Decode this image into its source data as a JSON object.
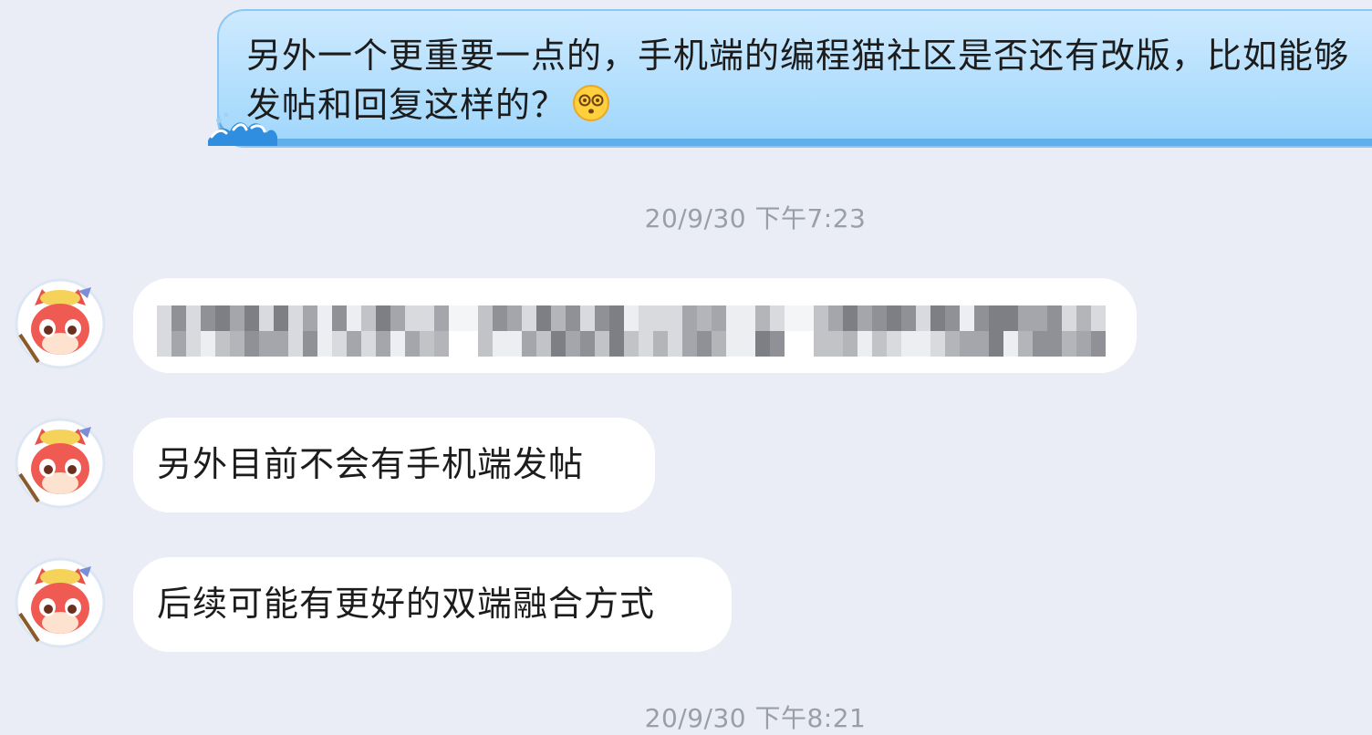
{
  "messages": {
    "outgoing": {
      "text": "另外一个更重要一点的，手机端的编程猫社区是否还有改版，比如能够发帖和回复这样的？",
      "emoji_icon": "dizzy-face-emoji"
    },
    "timestamp_1": "20/9/30 下午7:23",
    "incoming": [
      {
        "text": "",
        "redacted": true
      },
      {
        "text": "另外目前不会有手机端发帖"
      },
      {
        "text": "后续可能有更好的双端融合方式"
      }
    ],
    "timestamp_2": "20/9/30 下午8:21"
  },
  "colors": {
    "background": "#eaedf5",
    "outgoing_bubble": "#b7e0fd",
    "incoming_bubble": "#ffffff",
    "timestamp": "#9a9ea8"
  },
  "icons": {
    "avatar": "red-cat-mascot-avatar",
    "bubble_decoration": "wave-icon"
  }
}
